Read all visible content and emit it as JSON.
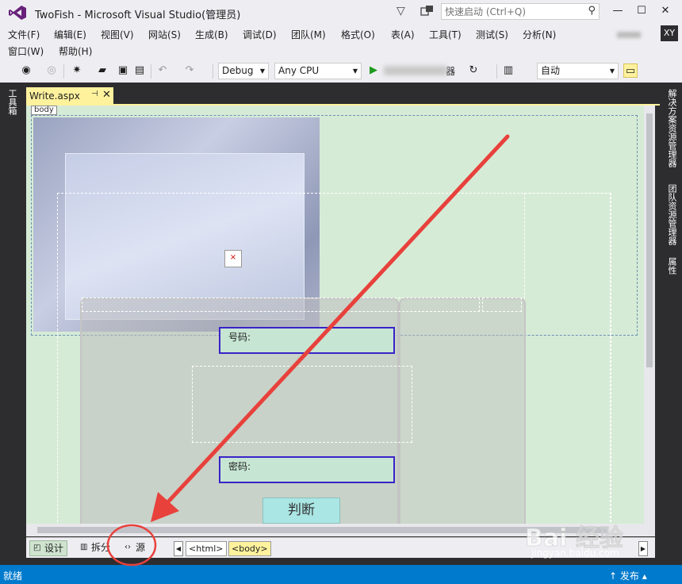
{
  "window": {
    "title": "TwoFish - Microsoft Visual Studio(管理员)",
    "quick_launch_placeholder": "快速启动 (Ctrl+Q)",
    "user_initials": "XY"
  },
  "menu": {
    "row1": [
      "文件(F)",
      "编辑(E)",
      "视图(V)",
      "网站(S)",
      "生成(B)",
      "调试(D)",
      "团队(M)",
      "格式(O)",
      "表(A)",
      "工具(T)",
      "测试(S)",
      "分析(N)"
    ],
    "row2": [
      "窗口(W)",
      "帮助(H)"
    ]
  },
  "toolbar": {
    "config": "Debug",
    "platform": "Any CPU",
    "run_suffix": "器",
    "auto": "自动"
  },
  "side_panels": {
    "left": "工具箱",
    "right": [
      "解决方案资源管理器",
      "团队资源管理器",
      "属性"
    ]
  },
  "document": {
    "tab_name": "Write.aspx",
    "body_tag": "body",
    "number_label": "号码:",
    "password_label": "密码:",
    "judge_button": "判断"
  },
  "view_bar": {
    "design": "设计",
    "split": "拆分",
    "source": "源",
    "crumbs": [
      "<html>",
      "<body>"
    ]
  },
  "status": {
    "left": "就绪",
    "right": "发布"
  },
  "watermark": {
    "brand": "Bai 经验",
    "url": "jingyan.baidu.com"
  },
  "colors": {
    "status_bar": "#007acc",
    "design_bg": "#d6ebd6",
    "tab_highlight": "#fff29d",
    "field_border": "#3a22c9",
    "button_bg": "#a9e6e4",
    "annotation": "#e8413c"
  }
}
